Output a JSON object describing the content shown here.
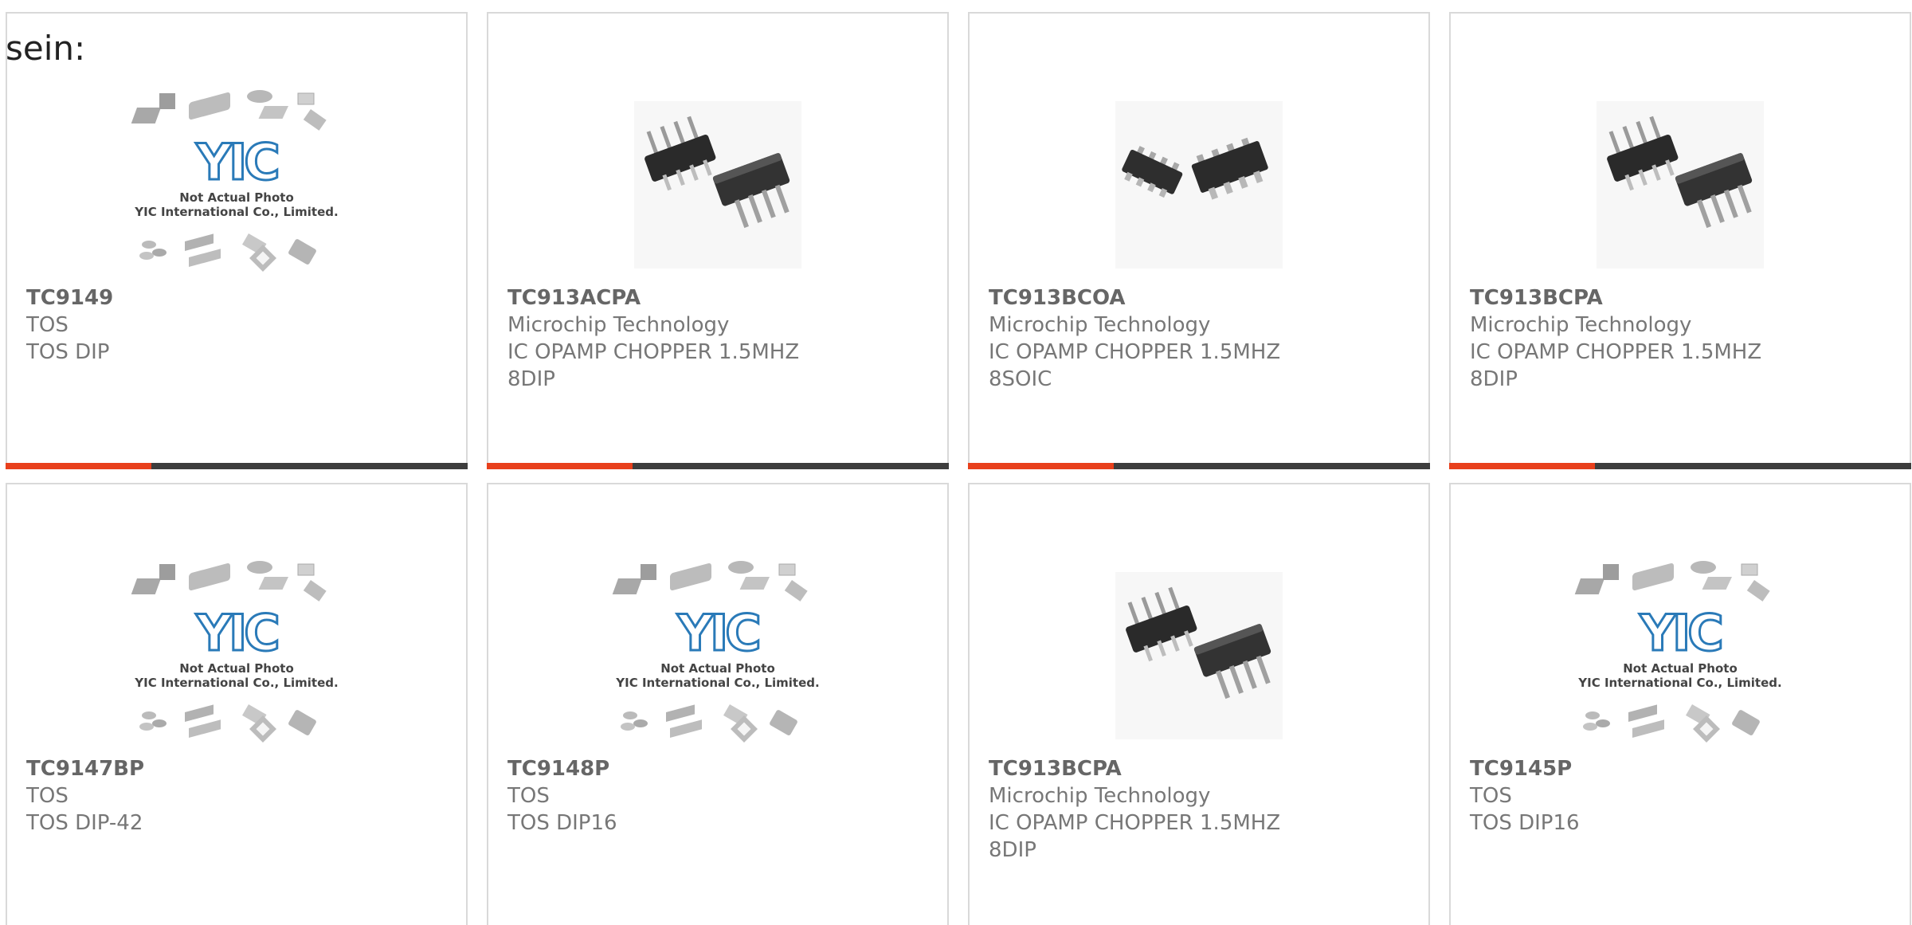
{
  "intro_text": "sein:",
  "placeholder_text": {
    "line1": "Not Actual Photo",
    "line2": "YIC International Co., Limited.",
    "logo": "YIC"
  },
  "colors": {
    "accent": "#e8401c",
    "bar_dark": "#3d3d3d",
    "card_border": "#d9d9d9",
    "text": "#777777",
    "logo_blue": "#2a7ab8"
  },
  "products": [
    {
      "part": "TC9149",
      "maker": "TOS",
      "desc": "TOS DIP",
      "extra": "",
      "image": "placeholder-yic"
    },
    {
      "part": "TC913ACPA",
      "maker": "Microchip Technology",
      "desc": "IC OPAMP CHOPPER 1.5MHZ",
      "extra": "8DIP",
      "image": "dip-chip"
    },
    {
      "part": "TC913BCOA",
      "maker": "Microchip Technology",
      "desc": "IC OPAMP CHOPPER 1.5MHZ",
      "extra": "8SOIC",
      "image": "soic-chip"
    },
    {
      "part": "TC913BCPA",
      "maker": "Microchip Technology",
      "desc": "IC OPAMP CHOPPER 1.5MHZ",
      "extra": "8DIP",
      "image": "dip-chip"
    },
    {
      "part": "TC9147BP",
      "maker": "TOS",
      "desc": "TOS DIP-42",
      "extra": "",
      "image": "placeholder-yic"
    },
    {
      "part": "TC9148P",
      "maker": "TOS",
      "desc": "TOS DIP16",
      "extra": "",
      "image": "placeholder-yic"
    },
    {
      "part": "TC913BCPA",
      "maker": "Microchip Technology",
      "desc": "IC OPAMP CHOPPER 1.5MHZ",
      "extra": "8DIP",
      "image": "dip-chip"
    },
    {
      "part": "TC9145P",
      "maker": "TOS",
      "desc": "TOS DIP16",
      "extra": "",
      "image": "placeholder-yic"
    }
  ]
}
